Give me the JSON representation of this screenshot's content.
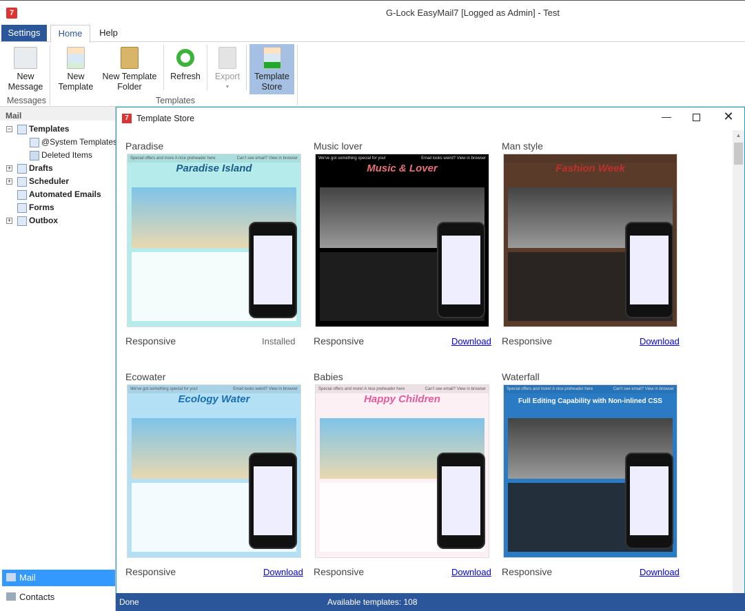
{
  "app": {
    "title": "G-Lock EasyMail7 [Logged as Admin] - Test"
  },
  "ribbon": {
    "tabs": [
      {
        "label": "Settings"
      },
      {
        "label": "Home"
      },
      {
        "label": "Help"
      }
    ],
    "buttons": {
      "new_message": "New\nMessage",
      "new_template": "New\nTemplate",
      "new_template_folder": "New Template\nFolder",
      "refresh": "Refresh",
      "export": "Export",
      "template_store": "Template\nStore"
    },
    "groups": {
      "messages": "Messages",
      "templates": "Templates"
    }
  },
  "sidebar": {
    "header": "Mail",
    "tree": [
      {
        "label": "Templates"
      },
      {
        "label": "@System Templates"
      },
      {
        "label": "Deleted Items"
      },
      {
        "label": "Drafts"
      },
      {
        "label": "Scheduler"
      },
      {
        "label": "Automated Emails"
      },
      {
        "label": "Forms"
      },
      {
        "label": "Outbox"
      }
    ],
    "nav": [
      {
        "label": "Mail"
      },
      {
        "label": "Contacts"
      }
    ]
  },
  "dialog": {
    "title": "Template Store",
    "templates": [
      {
        "name": "Paradise",
        "type": "Responsive",
        "action": "Installed",
        "preheader": "Special offers and more A nice preheader here",
        "preheader_right": "Can't see email? View in browser",
        "headline": "Paradise Island",
        "bg": "#b5ebea",
        "head_color": "#1a5c8a"
      },
      {
        "name": "Music lover",
        "type": "Responsive",
        "action": "Download",
        "preheader": "We've got something special for you!",
        "preheader_right": "Email looks weird? View in browser",
        "headline": "Music & Lover",
        "bg": "#000000",
        "head_color": "#e9707a"
      },
      {
        "name": "Man style",
        "type": "Responsive",
        "action": "Download",
        "preheader": "",
        "preheader_right": "",
        "headline": "Fashion Week",
        "bg": "#5a3b2a",
        "head_color": "#c0302a"
      },
      {
        "name": "Ecowater",
        "type": "Responsive",
        "action": "Download",
        "preheader": "We've got something special for you!",
        "preheader_right": "Email looks weird? View in browser",
        "headline": "Ecology Water",
        "bg": "#b3e0f5",
        "head_color": "#1a6fb0"
      },
      {
        "name": "Babies",
        "type": "Responsive",
        "action": "Download",
        "preheader": "Special offers and more! A nice preheader here",
        "preheader_right": "Can't see email? View in browser",
        "headline": "Happy Children",
        "bg": "#fdf0f4",
        "head_color": "#e85a9a"
      },
      {
        "name": "Waterfall",
        "type": "Responsive",
        "action": "Download",
        "preheader": "Special offers and more! A nice preheader here",
        "preheader_right": "Can't see email? View in browser",
        "headline": "Full Editing Capability with Non-inlined CSS",
        "bg": "#2a7bc4",
        "head_color": "#ffffff"
      }
    ]
  },
  "status": {
    "left": "Done",
    "right": "Available templates: 108"
  }
}
